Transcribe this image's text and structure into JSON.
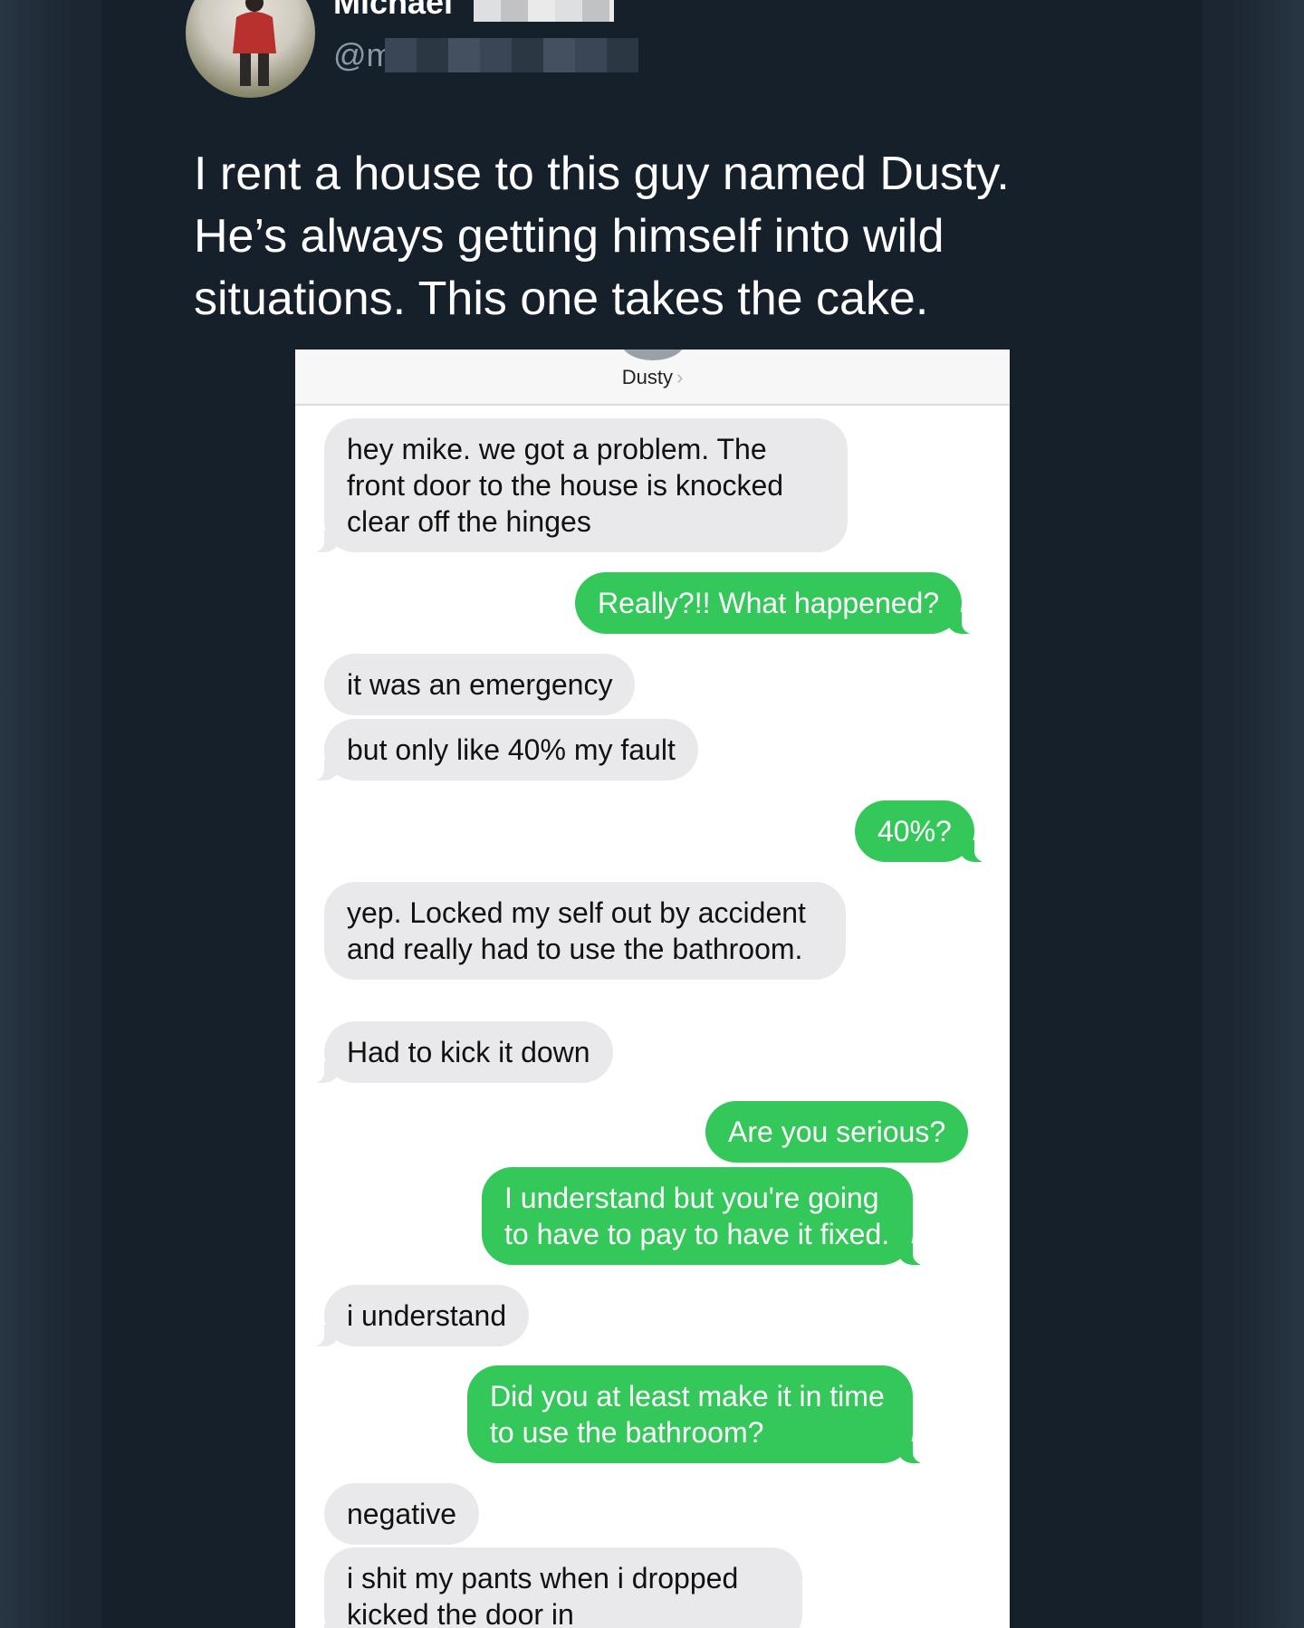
{
  "tweet": {
    "author_name": "Michael",
    "author_handle": "@m",
    "text": "I rent a house to this guy named Dusty. He’s always getting himself into wild situations. This one takes the cake."
  },
  "conversation": {
    "contact_name": "Dusty",
    "chevron": "›",
    "messages": [
      {
        "from": "Dusty",
        "text": "hey mike.  we got a problem. The front door to the house is knocked clear off the hinges"
      },
      {
        "from": "me",
        "text": "Really?!! What happened?"
      },
      {
        "from": "Dusty",
        "text": "it was an emergency"
      },
      {
        "from": "Dusty",
        "text": "but only like 40% my fault"
      },
      {
        "from": "me",
        "text": "40%?"
      },
      {
        "from": "Dusty",
        "text": "yep. Locked my self out by accident and really had to use the bathroom."
      },
      {
        "from": "Dusty",
        "text": "Had to kick it down"
      },
      {
        "from": "me",
        "text": "Are you serious?"
      },
      {
        "from": "me",
        "text": "I understand but you're going to have to pay to have it fixed."
      },
      {
        "from": "Dusty",
        "text": "i understand"
      },
      {
        "from": "me",
        "text": "Did you at least make it in time to use the bathroom?"
      },
      {
        "from": "Dusty",
        "text": "negative"
      },
      {
        "from": "Dusty",
        "text": "i shit my pants when i dropped kicked the door in"
      }
    ]
  },
  "colors": {
    "page_background": "#15202b",
    "incoming_bubble": "#e9e9eb",
    "outgoing_bubble": "#34c759"
  },
  "icons": {
    "avatar": "profile-photo-person-in-field"
  }
}
